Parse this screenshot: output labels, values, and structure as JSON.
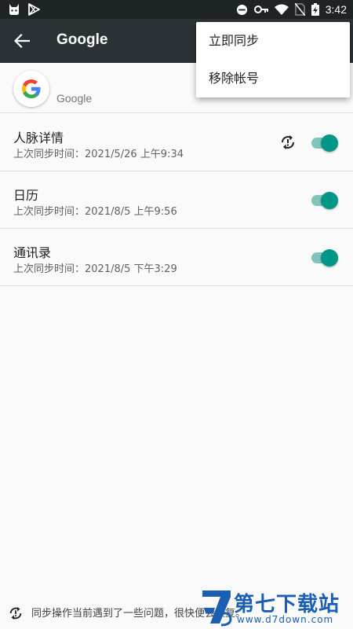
{
  "status_bar": {
    "time": "3:42",
    "icons": [
      "cat-icon",
      "play-store-icon",
      "do-not-disturb-icon",
      "key-icon",
      "wifi-icon",
      "no-sim-icon",
      "battery-charging-icon"
    ]
  },
  "app_bar": {
    "title": "Google",
    "back_icon": "arrow-left-icon"
  },
  "account": {
    "name": "Google",
    "logo_icon": "google-logo-icon"
  },
  "sync_items": [
    {
      "title": "人脉详情",
      "subtitle": "上次同步时间：2021/5/26 上午9:34",
      "enabled": true,
      "sync_error": true
    },
    {
      "title": "日历",
      "subtitle": "上次同步时间：2021/8/5 上午9:56",
      "enabled": true,
      "sync_error": false
    },
    {
      "title": "通讯录",
      "subtitle": "上次同步时间：2021/8/5 下午3:29",
      "enabled": true,
      "sync_error": false
    }
  ],
  "menu": {
    "items": [
      "立即同步",
      "移除帐号"
    ]
  },
  "footer": {
    "message": "同步操作当前遇到了一些问题，很快便会恢复。",
    "icon": "sync-problem-icon"
  },
  "watermark": {
    "title": "第七下载站",
    "url": "www.d7down.com"
  },
  "colors": {
    "accent": "#009688",
    "app_bar": "#2b3236",
    "status_bar": "#1e2326",
    "watermark": "#1b5fb4"
  }
}
